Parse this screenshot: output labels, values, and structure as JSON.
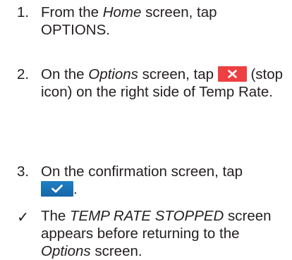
{
  "steps": [
    {
      "number": "1.",
      "line1_prefix": "From the ",
      "line1_em": "Home",
      "line1_suffix": " screen, tap",
      "line2": "OPTIONS."
    },
    {
      "number": "2.",
      "prefix": "On the ",
      "em": "Options",
      "middle": " screen, tap",
      "icon": "stop-icon",
      "suffix": "(stop icon) on the right side of Temp Rate."
    },
    {
      "number": "3.",
      "line1": "On the confirmation screen, tap",
      "icon": "checkmark-icon",
      "suffix": "."
    }
  ],
  "result": {
    "mark": "✓",
    "prefix": "The ",
    "em1": "TEMP RATE STOPPED",
    "middle": " screen appears before returning to the ",
    "em2": "Options",
    "suffix": " screen."
  },
  "colors": {
    "text": "#231f20",
    "stop_button": "#ee3f42",
    "check_button": "#1a73b8"
  }
}
